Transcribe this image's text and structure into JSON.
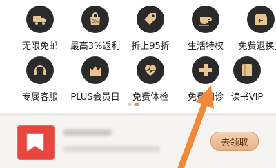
{
  "benefits_row1": [
    {
      "label": "无限免邮",
      "icon": "free-shipping-truck-icon"
    },
    {
      "label": "最高3%返利",
      "icon": "rebate-bag-icon"
    },
    {
      "label": "折上95折",
      "icon": "discount-tag-icon"
    },
    {
      "label": "生活特权",
      "icon": "coffee-cup-icon"
    },
    {
      "label": "免费退换货",
      "icon": "return-box-icon"
    }
  ],
  "benefits_row2": [
    {
      "label": "专属客服",
      "icon": "headset-icon"
    },
    {
      "label": "PLUS会员日",
      "icon": "crown-box-icon"
    },
    {
      "label": "免费体检",
      "icon": "heart-pulse-icon"
    },
    {
      "label": "免费问诊",
      "icon": "medical-cross-icon"
    },
    {
      "label": "读书VIP",
      "icon": "book-icon"
    }
  ],
  "pager": {
    "active_index": 1,
    "count": 2
  },
  "promo": {
    "claim_label": "去领取"
  },
  "colors": {
    "icon_bg": "#2b2a2a",
    "icon_fg": "#e8c590",
    "arrow": "#f08a3a",
    "accent": "#c9a36f"
  }
}
